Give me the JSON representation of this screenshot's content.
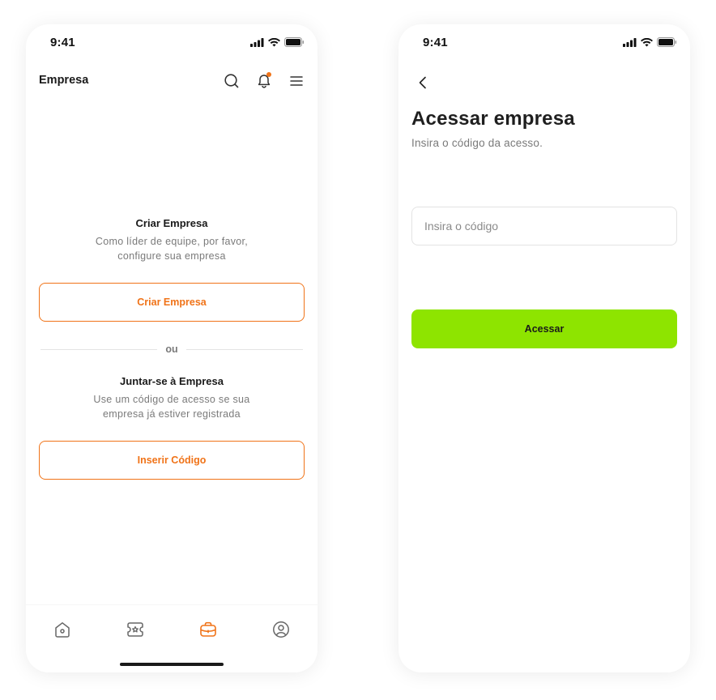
{
  "left_screen": {
    "status": {
      "time": "9:41"
    },
    "header": {
      "title": "Empresa"
    },
    "create": {
      "title": "Criar Empresa",
      "description": "Como líder de equipe, por favor, configure sua empresa",
      "button_label": "Criar Empresa"
    },
    "divider_label": "ou",
    "join": {
      "title": "Juntar-se à Empresa",
      "description": "Use um código de acesso se sua empresa já estiver registrada",
      "button_label": "Inserir Código"
    },
    "bottom_nav": {
      "items": [
        {
          "icon": "home-icon",
          "active": false
        },
        {
          "icon": "ticket-star-icon",
          "active": false
        },
        {
          "icon": "briefcase-icon",
          "active": true
        },
        {
          "icon": "profile-icon",
          "active": false
        }
      ]
    }
  },
  "right_screen": {
    "status": {
      "time": "9:41"
    },
    "title": "Acessar empresa",
    "subtitle": "Insira o código da acesso.",
    "code_input": {
      "placeholder": "Insira o código",
      "value": ""
    },
    "submit_label": "Acessar"
  },
  "colors": {
    "accent_orange": "#f07318",
    "primary_green": "#8ee400",
    "text_dark": "#1a1a1a",
    "text_muted": "#7a7a7a"
  }
}
